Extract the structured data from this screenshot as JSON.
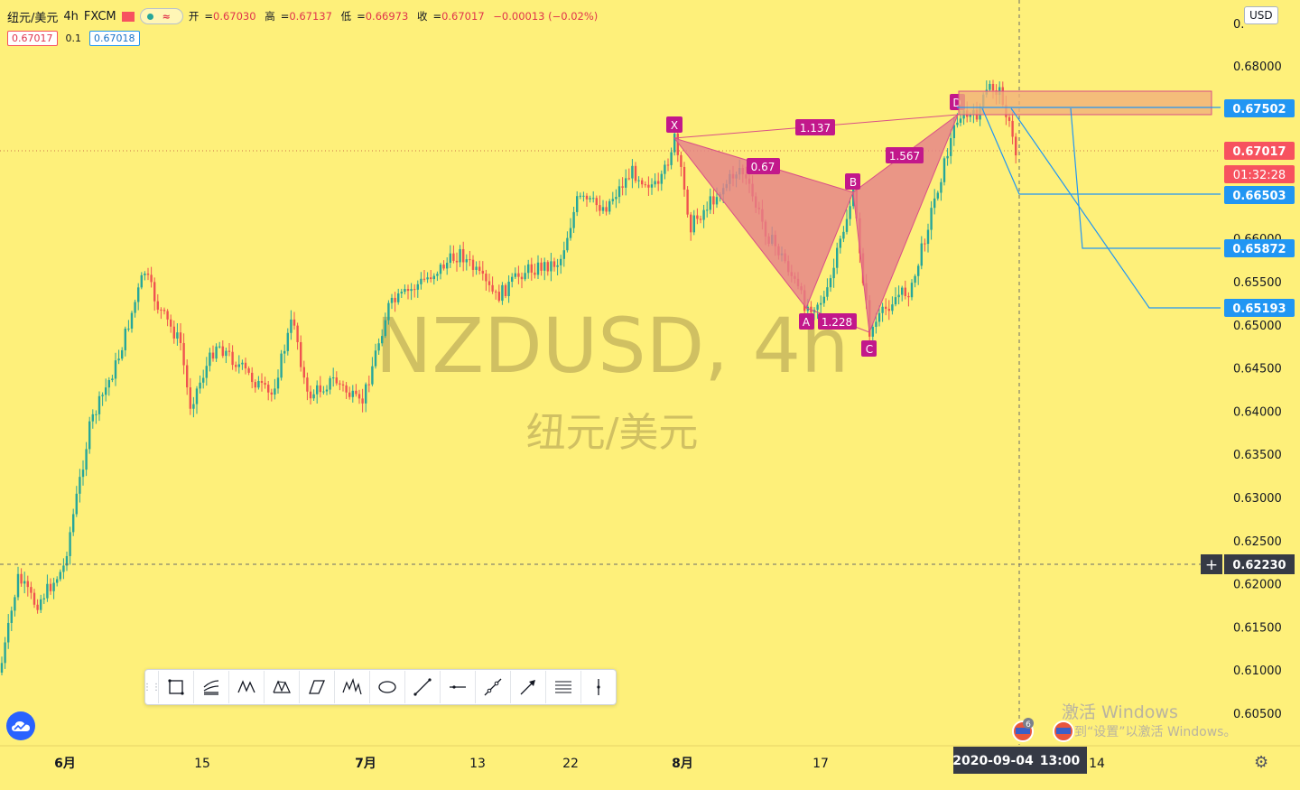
{
  "header": {
    "symbol_name": "纽元/美元",
    "interval": "4h",
    "exchange": "FXCM",
    "open_label": "开",
    "open": "0.67030",
    "high_label": "高",
    "high": "0.67137",
    "low_label": "低",
    "low": "0.66973",
    "close_label": "收",
    "close": "0.67017",
    "change": "−0.00013 (−0.02%)",
    "wave_glyph": "≈"
  },
  "quotes": {
    "sell": "0.67017",
    "spread": "0.1",
    "buy": "0.67018"
  },
  "currency": "USD",
  "watermark": {
    "symbol": "NZDUSD, 4h",
    "name": "纽元/美元"
  },
  "price_axis": {
    "ticks": [
      "0.68000",
      "0.67500",
      "0.66500",
      "0.66000",
      "0.65500",
      "0.65000",
      "0.64500",
      "0.64000",
      "0.63500",
      "0.63000",
      "0.62500",
      "0.62000",
      "0.61500",
      "0.61000",
      "0.60500"
    ],
    "top_tick_partial": "0."
  },
  "price_labels": {
    "target_1": "0.67502",
    "current": "0.67017",
    "countdown": "01:32:28",
    "target_2": "0.66503",
    "target_3": "0.65872",
    "target_4": "0.65193",
    "crosshair": "0.62230"
  },
  "time_axis": {
    "ticks": [
      "6月",
      "15",
      "7月",
      "13",
      "22",
      "8月",
      "17",
      "14"
    ],
    "crosshair_date": "2020-09-04",
    "crosshair_time": "13:00"
  },
  "pattern": {
    "points": [
      "X",
      "A",
      "B",
      "C",
      "D"
    ],
    "ratios": [
      "1.137",
      "0.67",
      "1.567",
      "1.228"
    ]
  },
  "toolbar": {
    "tools": [
      "rectangle-tool",
      "fib-channel-tool",
      "xabcd-pattern-tool",
      "cypher-pattern-tool",
      "abcd-pattern-tool",
      "elliott-wave-tool",
      "ellipse-tool",
      "trend-line-tool",
      "horizontal-ray-tool",
      "extended-line-tool",
      "arrow-tool",
      "parallel-lines-tool",
      "vertical-line-tool"
    ]
  },
  "windows_watermark": {
    "line1": "激活 Windows",
    "line2": "到“设置”以激活 Windows。"
  },
  "events_badge": "6",
  "colors": {
    "background": "#fef07a",
    "up": "#26a69a",
    "down": "#ef5350",
    "pattern_fill": "#e57f8a",
    "pattern_label": "#c2188b",
    "target_line": "#2196f3",
    "current_price": "#f7525f"
  }
}
